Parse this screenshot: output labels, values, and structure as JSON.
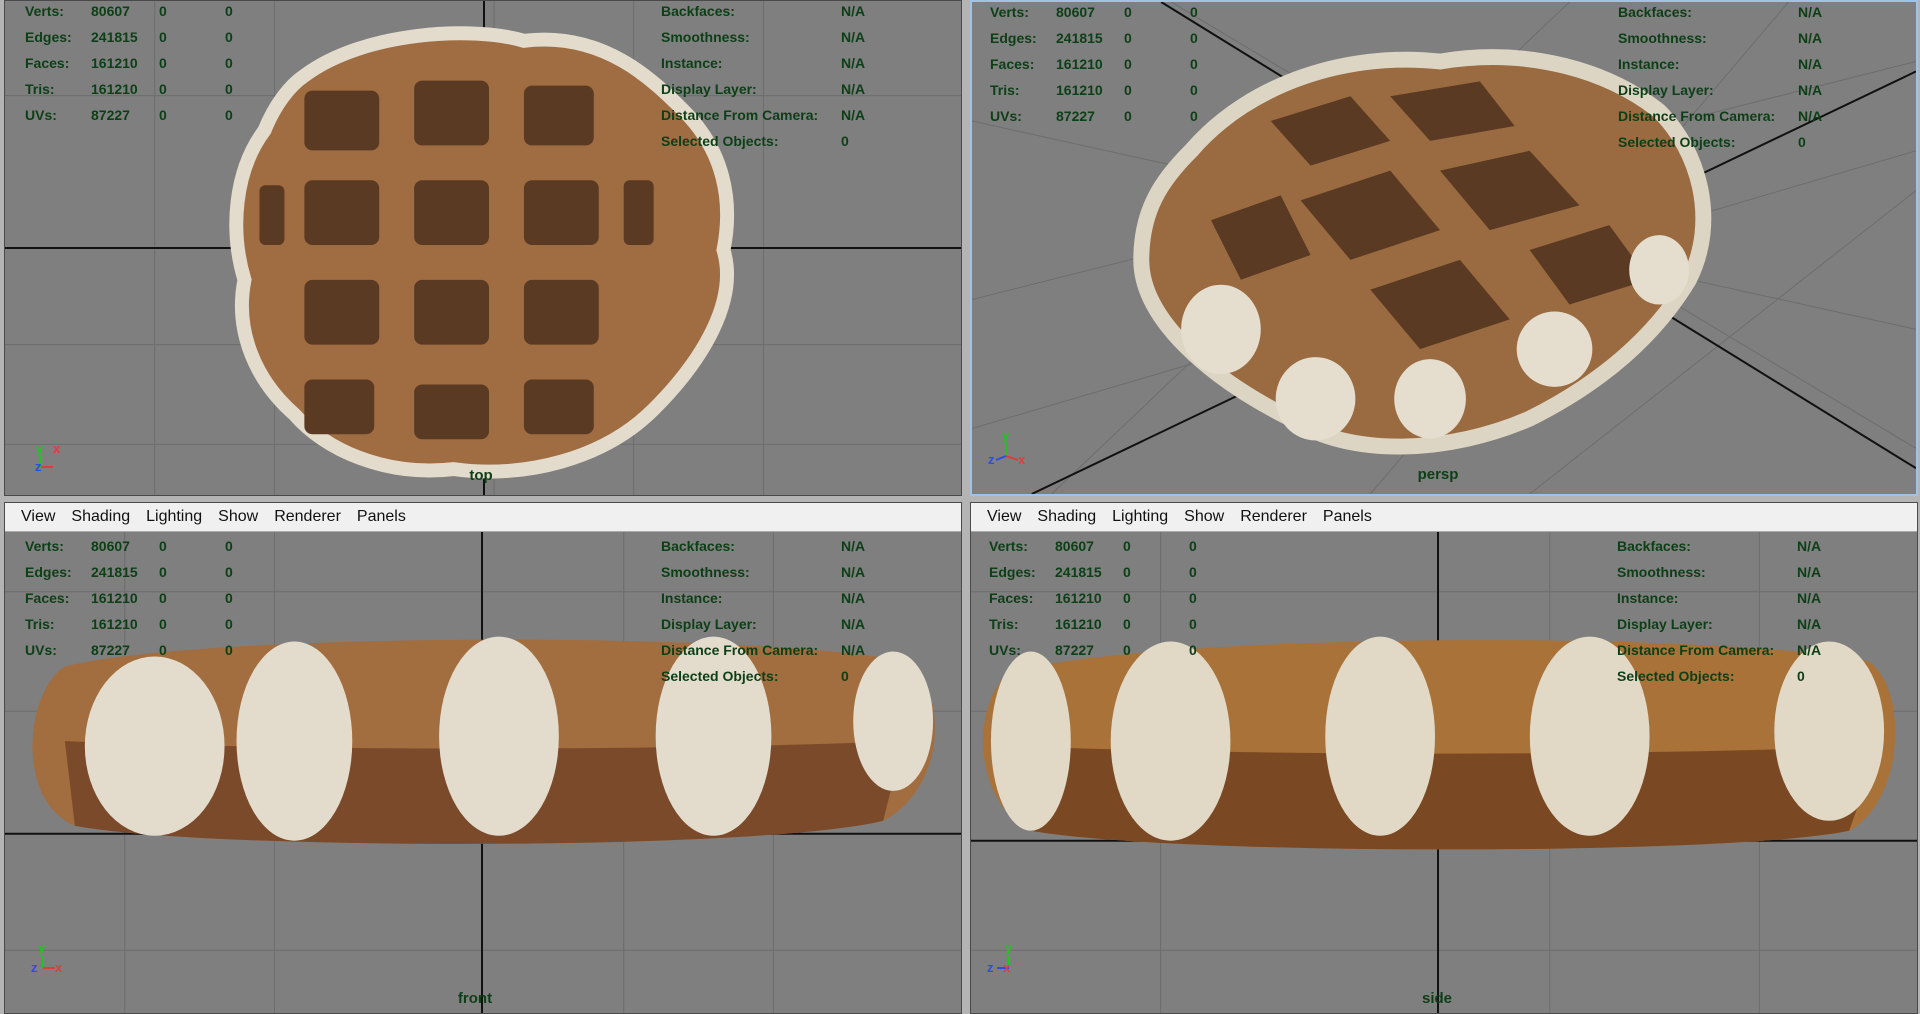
{
  "menu": [
    "View",
    "Shading",
    "Lighting",
    "Show",
    "Renderer",
    "Panels"
  ],
  "hud_left": [
    {
      "label": "Verts:",
      "v1": "80607",
      "v2": "0",
      "v3": "0"
    },
    {
      "label": "Edges:",
      "v1": "241815",
      "v2": "0",
      "v3": "0"
    },
    {
      "label": "Faces:",
      "v1": "161210",
      "v2": "0",
      "v3": "0"
    },
    {
      "label": "Tris:",
      "v1": "161210",
      "v2": "0",
      "v3": "0"
    },
    {
      "label": "UVs:",
      "v1": "87227",
      "v2": "0",
      "v3": "0"
    }
  ],
  "hud_right": [
    {
      "label": "Backfaces:",
      "value": "N/A"
    },
    {
      "label": "Smoothness:",
      "value": "N/A"
    },
    {
      "label": "Instance:",
      "value": "N/A"
    },
    {
      "label": "Display Layer:",
      "value": "N/A"
    },
    {
      "label": "Distance From Camera:",
      "value": "N/A"
    },
    {
      "label": "Selected Objects:",
      "value": "0"
    }
  ],
  "cameras": {
    "top": "top",
    "persp": "persp",
    "front": "front",
    "side": "side"
  },
  "axes": {
    "x": "x",
    "y": "y",
    "z": "z"
  },
  "colors": {
    "viewport_bg": "#7f7f7f",
    "hud_text": "#0d3f17",
    "grid": "#6b6b6b",
    "axis_line": "#111111",
    "waffle": "#9a6a40",
    "sugar": "#e9e2d2"
  }
}
